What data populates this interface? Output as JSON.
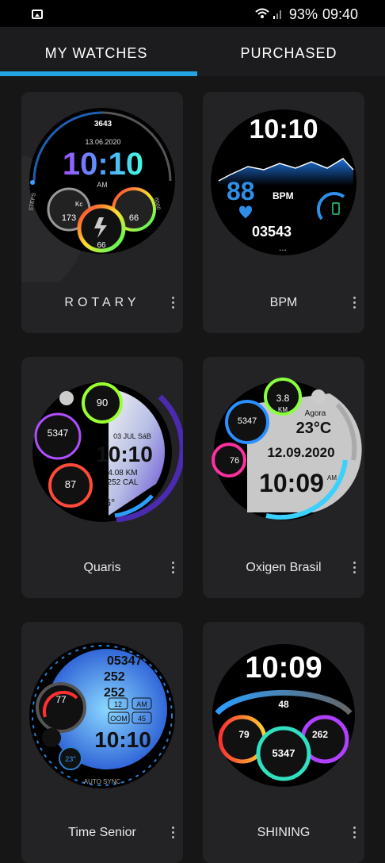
{
  "status": {
    "battery": "93%",
    "time": "09:40"
  },
  "tabs": {
    "my_watches": "MY WATCHES",
    "purchased": "PURCHASED"
  },
  "watches": [
    {
      "name": "ROTARY",
      "face": {
        "top": "3643",
        "date": "13.06.2020",
        "time": "10:10",
        "ampm": "AM",
        "left_label": "STEPS",
        "right_label": "6000",
        "g1_label": "Kc",
        "g1_value": "173",
        "g2_value": "66",
        "g3_value": "66"
      }
    },
    {
      "name": "BPM",
      "face": {
        "time": "10:10",
        "bpm": "88",
        "bpm_label": "BPM",
        "steps": "03543",
        "dots": "..."
      }
    },
    {
      "name": "Quaris",
      "face": {
        "g1": "90",
        "g2": "5347",
        "g3": "87",
        "date": "03 JUL SáB",
        "time": "10:10",
        "dist": "4.08 KM",
        "cal": "252 CAL",
        "temp": "6°"
      }
    },
    {
      "name": "Oxigen Brasil",
      "face": {
        "g1": "3.8",
        "g1_label": "KM",
        "g2": "5347",
        "g3": "76",
        "weather_label": "Agora",
        "temp": "23°C",
        "date": "12.09.2020",
        "time": "10:09",
        "ampm": "AM"
      }
    },
    {
      "name": "Time Senior",
      "face": {
        "steps": "05347",
        "walk": "252",
        "dist": "252",
        "g1": "77",
        "day": "12",
        "ampm": "AM",
        "b1": "OOM",
        "b2": "45",
        "time": "10:10",
        "temp": "23°",
        "sync": "AUTO SYNC"
      }
    },
    {
      "name": "SHINING",
      "face": {
        "time": "10:09",
        "top": "48",
        "left": "79",
        "center": "5347",
        "right": "262"
      }
    }
  ],
  "colors": {
    "accent": "#23a3e2",
    "card": "#232325",
    "bg": "#161616"
  }
}
